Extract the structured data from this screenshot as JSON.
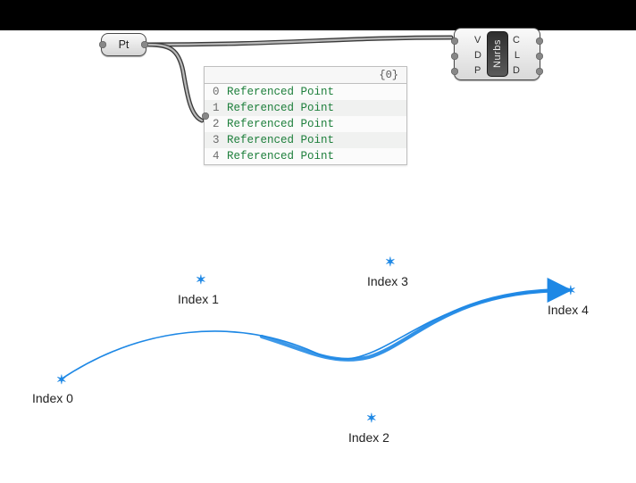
{
  "pt_node": {
    "label": "Pt"
  },
  "nurbs_node": {
    "label": "Nurbs",
    "inputs": {
      "v": "V",
      "d": "D",
      "p": "P"
    },
    "outputs": {
      "c": "C",
      "l": "L",
      "d": "D"
    }
  },
  "panel": {
    "path": "{0}",
    "items": [
      {
        "index": "0",
        "value": "Referenced Point"
      },
      {
        "index": "1",
        "value": "Referenced Point"
      },
      {
        "index": "2",
        "value": "Referenced Point"
      },
      {
        "index": "3",
        "value": "Referenced Point"
      },
      {
        "index": "4",
        "value": "Referenced Point"
      }
    ]
  },
  "viewport": {
    "points": [
      {
        "label": "Index 0"
      },
      {
        "label": "Index 1"
      },
      {
        "label": "Index 2"
      },
      {
        "label": "Index 3"
      },
      {
        "label": "Index 4"
      }
    ]
  },
  "colors": {
    "curve": "#1e88e5",
    "wire": "#555555"
  }
}
